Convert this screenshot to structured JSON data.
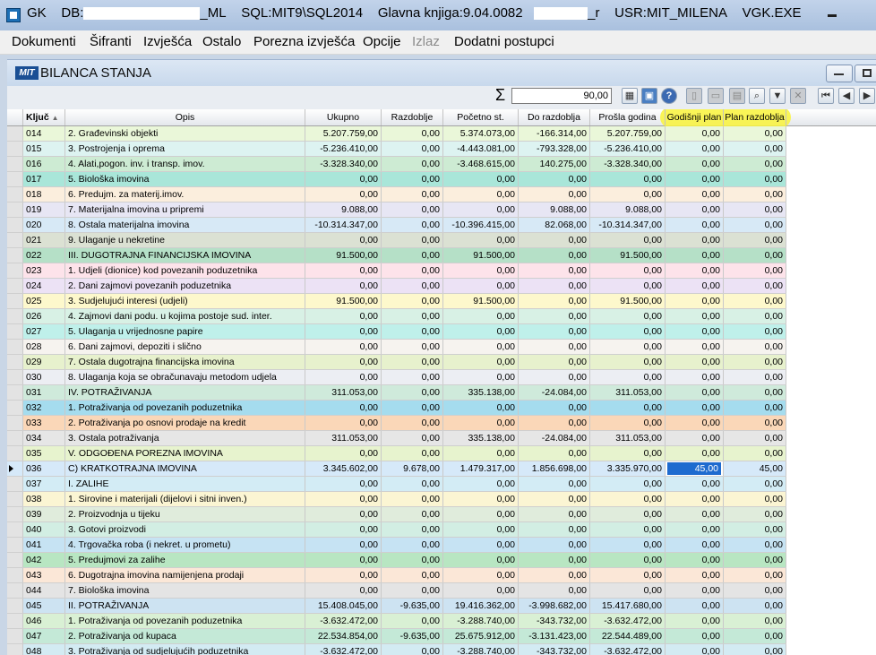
{
  "titlebar": {
    "app": "GK",
    "db_prefix": "DB:",
    "db_suffix": "_ML",
    "sql": "SQL:MIT9\\SQL2014",
    "glavna": "Glavna knjiga:9.04.0082",
    "r_suffix": "_r",
    "usr": "USR:MIT_MILENA",
    "exe": "VGK.EXE"
  },
  "menu": {
    "items": [
      "Dokumenti",
      "Šifranti",
      "Izvješća",
      "Ostalo",
      "Porezna izvješća",
      "Opcije",
      "Izlaz",
      "Dodatni postupci"
    ]
  },
  "window": {
    "icon_text": "MIT",
    "title": "BILANCA STANJA"
  },
  "toolbar": {
    "sigma": "Σ",
    "sum_value": "90,00"
  },
  "grid": {
    "headers": [
      "Ključ",
      "Opis",
      "Ukupno",
      "Razdoblje",
      "Početno st.",
      "Do razdoblja",
      "Prošla godina",
      "Godišnji plan",
      "Plan razdoblja"
    ],
    "rows": [
      {
        "k": "014",
        "o": "2. Građevinski objekti",
        "u": "5.207.759,00",
        "r": "0,00",
        "p": "5.374.073,00",
        "d": "-166.314,00",
        "pg": "5.207.759,00",
        "gp": "0,00",
        "pr": "0,00",
        "c": "#eaf7d9"
      },
      {
        "k": "015",
        "o": "3. Postrojenja i oprema",
        "u": "-5.236.410,00",
        "r": "0,00",
        "p": "-4.443.081,00",
        "d": "-793.328,00",
        "pg": "-5.236.410,00",
        "gp": "0,00",
        "pr": "0,00",
        "c": "#ddf3f1"
      },
      {
        "k": "016",
        "o": "4. Alati,pogon. inv. i transp. imov.",
        "u": "-3.328.340,00",
        "r": "0,00",
        "p": "-3.468.615,00",
        "d": "140.275,00",
        "pg": "-3.328.340,00",
        "gp": "0,00",
        "pr": "0,00",
        "c": "#cdebd3"
      },
      {
        "k": "017",
        "o": "5. Biološka imovina",
        "u": "0,00",
        "r": "0,00",
        "p": "0,00",
        "d": "0,00",
        "pg": "0,00",
        "gp": "0,00",
        "pr": "0,00",
        "c": "#a9e6d9"
      },
      {
        "k": "018",
        "o": "6. Predujm. za materij.imov.",
        "u": "0,00",
        "r": "0,00",
        "p": "0,00",
        "d": "0,00",
        "pg": "0,00",
        "gp": "0,00",
        "pr": "0,00",
        "c": "#fbeedd"
      },
      {
        "k": "019",
        "o": "7. Materijalna imovina u pripremi",
        "u": "9.088,00",
        "r": "0,00",
        "p": "0,00",
        "d": "9.088,00",
        "pg": "9.088,00",
        "gp": "0,00",
        "pr": "0,00",
        "c": "#e7e6f4"
      },
      {
        "k": "020",
        "o": "8. Ostala materijalna imovina",
        "u": "-10.314.347,00",
        "r": "0,00",
        "p": "-10.396.415,00",
        "d": "82.068,00",
        "pg": "-10.314.347,00",
        "gp": "0,00",
        "pr": "0,00",
        "c": "#d7e9f6"
      },
      {
        "k": "021",
        "o": "9. Ulaganje u nekretine",
        "u": "0,00",
        "r": "0,00",
        "p": "0,00",
        "d": "0,00",
        "pg": "0,00",
        "gp": "0,00",
        "pr": "0,00",
        "c": "#dbe1d3"
      },
      {
        "k": "022",
        "o": "III. DUGOTRAJNA FINANCIJSKA IMOVINA",
        "u": "91.500,00",
        "r": "0,00",
        "p": "91.500,00",
        "d": "0,00",
        "pg": "91.500,00",
        "gp": "0,00",
        "pr": "0,00",
        "c": "#b5e0c7"
      },
      {
        "k": "023",
        "o": "1. Udjeli (dionice) kod povezanih poduzetnika",
        "u": "0,00",
        "r": "0,00",
        "p": "0,00",
        "d": "0,00",
        "pg": "0,00",
        "gp": "0,00",
        "pr": "0,00",
        "c": "#fde3ea"
      },
      {
        "k": "024",
        "o": "2. Dani zajmovi povezanih poduzetnika",
        "u": "0,00",
        "r": "0,00",
        "p": "0,00",
        "d": "0,00",
        "pg": "0,00",
        "gp": "0,00",
        "pr": "0,00",
        "c": "#ece2f5"
      },
      {
        "k": "025",
        "o": "3. Sudjelujući interesi (udjeli)",
        "u": "91.500,00",
        "r": "0,00",
        "p": "91.500,00",
        "d": "0,00",
        "pg": "91.500,00",
        "gp": "0,00",
        "pr": "0,00",
        "c": "#fdf8cc"
      },
      {
        "k": "026",
        "o": "4. Zajmovi dani podu. u kojima postoje sud. inter.",
        "u": "0,00",
        "r": "0,00",
        "p": "0,00",
        "d": "0,00",
        "pg": "0,00",
        "gp": "0,00",
        "pr": "0,00",
        "c": "#d8f1e5"
      },
      {
        "k": "027",
        "o": "5. Ulaganja u vrijednosne papire",
        "u": "0,00",
        "r": "0,00",
        "p": "0,00",
        "d": "0,00",
        "pg": "0,00",
        "gp": "0,00",
        "pr": "0,00",
        "c": "#bff0ea"
      },
      {
        "k": "028",
        "o": "6. Dani zajmovi, depoziti i slično",
        "u": "0,00",
        "r": "0,00",
        "p": "0,00",
        "d": "0,00",
        "pg": "0,00",
        "gp": "0,00",
        "pr": "0,00",
        "c": "#f6f3ef"
      },
      {
        "k": "029",
        "o": "7. Ostala dugotrajna financijska imovina",
        "u": "0,00",
        "r": "0,00",
        "p": "0,00",
        "d": "0,00",
        "pg": "0,00",
        "gp": "0,00",
        "pr": "0,00",
        "c": "#e7f1cd"
      },
      {
        "k": "030",
        "o": "8. Ulaganja koja se obračunavaju metodom udjela",
        "u": "0,00",
        "r": "0,00",
        "p": "0,00",
        "d": "0,00",
        "pg": "0,00",
        "gp": "0,00",
        "pr": "0,00",
        "c": "#eceef3"
      },
      {
        "k": "031",
        "o": "IV. POTRAŽIVANJA",
        "u": "311.053,00",
        "r": "0,00",
        "p": "335.138,00",
        "d": "-24.084,00",
        "pg": "311.053,00",
        "gp": "0,00",
        "pr": "0,00",
        "c": "#cfeadb"
      },
      {
        "k": "032",
        "o": "1. Potraživanja od povezanih poduzetnika",
        "u": "0,00",
        "r": "0,00",
        "p": "0,00",
        "d": "0,00",
        "pg": "0,00",
        "gp": "0,00",
        "pr": "0,00",
        "c": "#a5dcee"
      },
      {
        "k": "033",
        "o": "2. Potraživanja po osnovi prodaje na kredit",
        "u": "0,00",
        "r": "0,00",
        "p": "0,00",
        "d": "0,00",
        "pg": "0,00",
        "gp": "0,00",
        "pr": "0,00",
        "c": "#fad7b8"
      },
      {
        "k": "034",
        "o": "3. Ostala potraživanja",
        "u": "311.053,00",
        "r": "0,00",
        "p": "335.138,00",
        "d": "-24.084,00",
        "pg": "311.053,00",
        "gp": "0,00",
        "pr": "0,00",
        "c": "#e6e6e6"
      },
      {
        "k": "035",
        "o": "V. ODGOĐENA POREZNA IMOVINA",
        "u": "0,00",
        "r": "0,00",
        "p": "0,00",
        "d": "0,00",
        "pg": "0,00",
        "gp": "0,00",
        "pr": "0,00",
        "c": "#e7f3ce"
      },
      {
        "k": "036",
        "o": "C) KRATKOTRAJNA IMOVINA",
        "u": "3.345.602,00",
        "r": "9.678,00",
        "p": "1.479.317,00",
        "d": "1.856.698,00",
        "pg": "3.335.970,00",
        "gp": "45,00",
        "pr": "45,00",
        "c": "#d6e9f9",
        "sel": true
      },
      {
        "k": "037",
        "o": "I. ZALIHE",
        "u": "0,00",
        "r": "0,00",
        "p": "0,00",
        "d": "0,00",
        "pg": "0,00",
        "gp": "0,00",
        "pr": "0,00",
        "c": "#d3ecf5"
      },
      {
        "k": "038",
        "o": "1. Sirovine i materijali (dijelovi i sitni inven.)",
        "u": "0,00",
        "r": "0,00",
        "p": "0,00",
        "d": "0,00",
        "pg": "0,00",
        "gp": "0,00",
        "pr": "0,00",
        "c": "#fbf5d3"
      },
      {
        "k": "039",
        "o": "2. Proizvodnja u tijeku",
        "u": "0,00",
        "r": "0,00",
        "p": "0,00",
        "d": "0,00",
        "pg": "0,00",
        "gp": "0,00",
        "pr": "0,00",
        "c": "#e0ecdc"
      },
      {
        "k": "040",
        "o": "3. Gotovi proizvodi",
        "u": "0,00",
        "r": "0,00",
        "p": "0,00",
        "d": "0,00",
        "pg": "0,00",
        "gp": "0,00",
        "pr": "0,00",
        "c": "#d2eee3"
      },
      {
        "k": "041",
        "o": "4. Trgovačka roba (i nekret. u prometu)",
        "u": "0,00",
        "r": "0,00",
        "p": "0,00",
        "d": "0,00",
        "pg": "0,00",
        "gp": "0,00",
        "pr": "0,00",
        "c": "#c6e3f3"
      },
      {
        "k": "042",
        "o": "5. Predujmovi za zalihe",
        "u": "0,00",
        "r": "0,00",
        "p": "0,00",
        "d": "0,00",
        "pg": "0,00",
        "gp": "0,00",
        "pr": "0,00",
        "c": "#b8e6c2"
      },
      {
        "k": "043",
        "o": "6. Dugotrajna imovina namijenjena prodaji",
        "u": "0,00",
        "r": "0,00",
        "p": "0,00",
        "d": "0,00",
        "pg": "0,00",
        "gp": "0,00",
        "pr": "0,00",
        "c": "#fbe7d7"
      },
      {
        "k": "044",
        "o": "7. Biološka imovina",
        "u": "0,00",
        "r": "0,00",
        "p": "0,00",
        "d": "0,00",
        "pg": "0,00",
        "gp": "0,00",
        "pr": "0,00",
        "c": "#e4e4e4"
      },
      {
        "k": "045",
        "o": "II. POTRAŽIVANJA",
        "u": "15.408.045,00",
        "r": "-9.635,00",
        "p": "19.416.362,00",
        "d": "-3.998.682,00",
        "pg": "15.417.680,00",
        "gp": "0,00",
        "pr": "0,00",
        "c": "#cde3f2"
      },
      {
        "k": "046",
        "o": "1. Potraživanja od povezanih poduzetnika",
        "u": "-3.632.472,00",
        "r": "0,00",
        "p": "-3.288.740,00",
        "d": "-343.732,00",
        "pg": "-3.632.472,00",
        "gp": "0,00",
        "pr": "0,00",
        "c": "#d9f0d4"
      },
      {
        "k": "047",
        "o": "2. Potraživanja od kupaca",
        "u": "22.534.854,00",
        "r": "-9.635,00",
        "p": "25.675.912,00",
        "d": "-3.131.423,00",
        "pg": "22.544.489,00",
        "gp": "0,00",
        "pr": "0,00",
        "c": "#c4e9d7"
      },
      {
        "k": "048",
        "o": "3. Potraživanja od sudjelujućih poduzetnika",
        "u": "-3.632.472,00",
        "r": "0,00",
        "p": "-3.288.740,00",
        "d": "-343.732,00",
        "pg": "-3.632.472,00",
        "gp": "0,00",
        "pr": "0,00",
        "c": "#d3ebf3"
      }
    ]
  }
}
